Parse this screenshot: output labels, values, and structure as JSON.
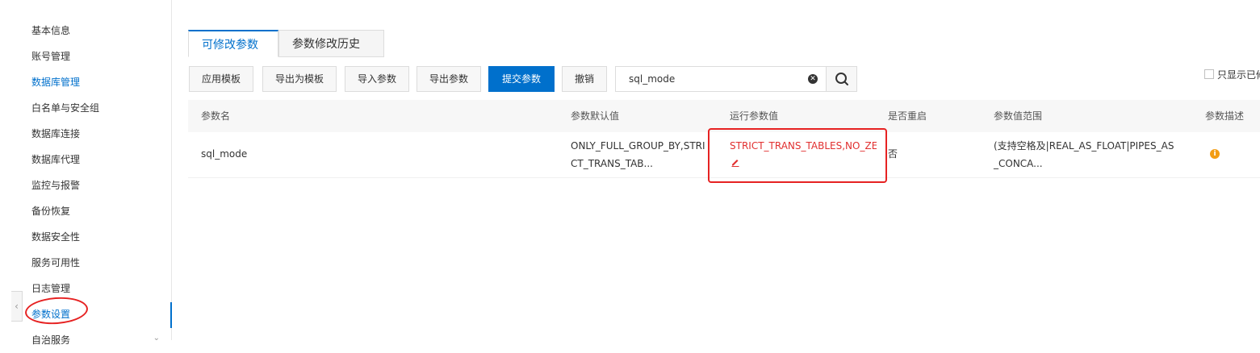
{
  "sidebar": {
    "items": [
      {
        "label": "基本信息"
      },
      {
        "label": "账号管理"
      },
      {
        "label": "数据库管理"
      },
      {
        "label": "白名单与安全组"
      },
      {
        "label": "数据库连接"
      },
      {
        "label": "数据库代理"
      },
      {
        "label": "监控与报警"
      },
      {
        "label": "备份恢复"
      },
      {
        "label": "数据安全性"
      },
      {
        "label": "服务可用性"
      },
      {
        "label": "日志管理"
      },
      {
        "label": "参数设置"
      },
      {
        "label": "自治服务"
      }
    ],
    "active_item": "参数设置",
    "collapse_icon": "chevron-left-icon"
  },
  "tabs": [
    {
      "label": "可修改参数",
      "active": true
    },
    {
      "label": "参数修改历史",
      "active": false
    }
  ],
  "toolbar": {
    "apply_template": "应用模板",
    "export_template": "导出为模板",
    "import_params": "导入参数",
    "export_params": "导出参数",
    "submit_params": "提交参数",
    "revoke": "撤销"
  },
  "search": {
    "value": "sql_mode",
    "clear_icon": "clear-icon",
    "search_icon": "search-icon"
  },
  "filter": {
    "checkbox_label": "只显示已修改"
  },
  "table": {
    "headers": [
      "参数名",
      "参数默认值",
      "运行参数值",
      "是否重启",
      "参数值范围",
      "参数描述"
    ],
    "rows": [
      {
        "name": "sql_mode",
        "default_value": "ONLY_FULL_GROUP_BY,STRICT_TRANS_TAB...",
        "running_value": "STRICT_TRANS_TABLES,NO_ZE",
        "restart": "否",
        "range": "(支持空格及|REAL_AS_FLOAT|PIPES_AS_CONCA...",
        "description_icon": "info-icon"
      }
    ]
  },
  "colors": {
    "accent": "#0070cc",
    "highlight": "#e62222",
    "info": "#f39c12"
  }
}
